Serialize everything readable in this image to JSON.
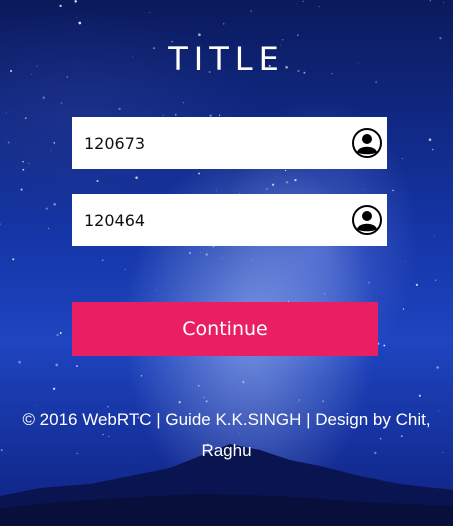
{
  "header": {
    "title": "TITLE"
  },
  "form": {
    "field1": {
      "value": "120673",
      "icon": "user-circle-icon"
    },
    "field2": {
      "value": "120464",
      "icon": "user-circle-icon"
    },
    "continue_label": "Continue"
  },
  "footer": {
    "line1": "© 2016 WebRTC | Guide K.K.SINGH | Design by Chit,",
    "line2": "Raghu"
  },
  "colors": {
    "button": "#e91e63",
    "background": "#1536a8",
    "text": "#ffffff"
  }
}
